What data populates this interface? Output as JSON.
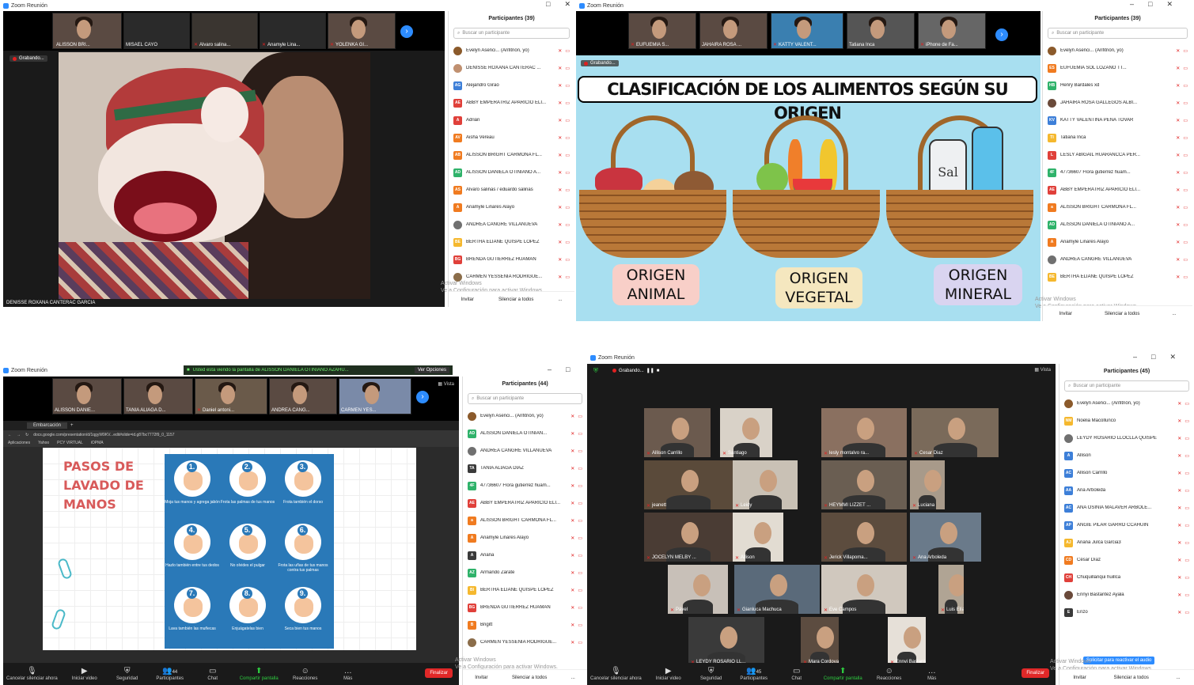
{
  "app_title": "Zoom Reunión",
  "q1": {
    "thumbnails": [
      "ALISSON BRI...",
      "MISAEL CAYO",
      "Alvaro salina...",
      "Anamyle Lina...",
      "YOLENKA GI..."
    ],
    "recording": "Grabando...",
    "speaker": "DENISSE ROXANA CANTERAC GARCIA",
    "panel_title": "Participantes (39)",
    "search_placeholder": "Buscar un participante",
    "participants": [
      {
        "initials": "",
        "name": "Evelyn Asenci... (Anfitrión, yo)",
        "color": "#8b5a2b",
        "photo": true
      },
      {
        "initials": "",
        "name": "DENISSE ROXANA CANTERAC ...",
        "color": "#c09070",
        "photo": true
      },
      {
        "initials": "AG",
        "name": "Alejandro Girao",
        "color": "#3d7fd8"
      },
      {
        "initials": "AE",
        "name": "ABBY EMPERATRIZ APARICIO ELI...",
        "color": "#e0403a"
      },
      {
        "initials": "A",
        "name": "Adrián",
        "color": "#e0403a"
      },
      {
        "initials": "AV",
        "name": "Aisha Vereau",
        "color": "#f07b20"
      },
      {
        "initials": "AB",
        "name": "ALISSON BRIGHT CARMONA FL...",
        "color": "#f07b20"
      },
      {
        "initials": "AD",
        "name": "ALISSON DANIELA OTINIANO A...",
        "color": "#2fb26a"
      },
      {
        "initials": "AS",
        "name": "Alvaro salinas / eduardo salinas",
        "color": "#f07b20"
      },
      {
        "initials": "A",
        "name": "Anamyle Linares Alayo",
        "color": "#f07b20"
      },
      {
        "initials": "",
        "name": "ANDREA CANGRE VILLANUEVA",
        "color": "#707070",
        "photo": true
      },
      {
        "initials": "BE",
        "name": "BERTHA ELIANE QUISPE LOPEZ",
        "color": "#f5b82e"
      },
      {
        "initials": "BG",
        "name": "BRENDA GUTIERREZ HUAMAN",
        "color": "#e0403a"
      },
      {
        "initials": "",
        "name": "CARMEN YESSENIA RODRIGUE...",
        "color": "#8b6d4a",
        "photo": true
      }
    ],
    "invite": "Invitar",
    "mute_all": "Silenciar a todos",
    "more": "...",
    "activate1": "Activar Windows",
    "activate2": "Ve a Configuración para activar Windows."
  },
  "q2": {
    "thumbnails": [
      "EUFUEMIA S...",
      "JAHAIRA ROSA ...",
      "KATTY VALENT...",
      "Tatiana Inca",
      "iPhone de Fa..."
    ],
    "recording": "Grabando...",
    "slide_title": "CLASIFICACIÓN DE LOS ALIMENTOS SEGÚN SU ORIGEN",
    "labels": [
      "ORIGEN ANIMAL",
      "ORIGEN VEGETAL",
      "ORIGEN MINERAL"
    ],
    "salt_text": "Sal",
    "panel_title": "Participantes (39)",
    "search_placeholder": "Buscar un participante",
    "participants": [
      {
        "initials": "",
        "name": "Evelyn Asenci... (Anfitrión, yo)",
        "color": "#8b5a2b",
        "photo": true
      },
      {
        "initials": "ES",
        "name": "EUFUEMIA SOL LOZANO TT...",
        "color": "#f07b20"
      },
      {
        "initials": "HB",
        "name": "Henry Bardales xd",
        "color": "#2fb26a"
      },
      {
        "initials": "",
        "name": "JAHAIRA ROSA GALLEGOS ALBI...",
        "color": "#6a4a3a",
        "photo": true
      },
      {
        "initials": "KV",
        "name": "KATTY VALENTINA PEÑA TOVAR",
        "color": "#3d7fd8"
      },
      {
        "initials": "TI",
        "name": "Tatiana Inca",
        "color": "#f5b82e"
      },
      {
        "initials": "L",
        "name": "LESLY ABIGAIL HUARANCCA PER...",
        "color": "#e0403a"
      },
      {
        "initials": "4F",
        "name": "47736607 Flora gutierrez huam...",
        "color": "#2fb26a"
      },
      {
        "initials": "AE",
        "name": "ABBY EMPERATRIZ APARICIO ELI...",
        "color": "#e0403a"
      },
      {
        "initials": "a",
        "name": "ALISSON BRIGHT CARMONA FL...",
        "color": "#f07b20"
      },
      {
        "initials": "AD",
        "name": "ALISSON DANIELA OTINIANO A...",
        "color": "#2fb26a"
      },
      {
        "initials": "A",
        "name": "Anamyle Linares Alayo",
        "color": "#f07b20"
      },
      {
        "initials": "",
        "name": "ANDREA CANGRE VILLANUEVA",
        "color": "#707070",
        "photo": true
      },
      {
        "initials": "BE",
        "name": "BERTHA ELIANE QUISPE LOPEZ",
        "color": "#f5b82e"
      }
    ],
    "invite": "Invitar",
    "mute_all": "Silenciar a todos",
    "more": "...",
    "activate1": "Activar Windows",
    "activate2": "Ve a Configuración para activar Windows."
  },
  "q3": {
    "share_notice": "Usted está viendo la pantalla de ALISSON DANIELA OTINIANO AZAHU...",
    "view_options": "Ver Opciones",
    "view": "Vista",
    "thumbnails": [
      "ALISSON DANIE...",
      "TANIA ALIAGA D...",
      "Daniel antoni...",
      "ANDREA CANG...",
      "CARMEN YES..."
    ],
    "browser_tab": "Embarcación",
    "url": "docs.google.com/presentation/d/1qgyW9KV...edit#slide=id.g87bc7772f9_0_1157",
    "bookmarks": [
      "Aplicaciones",
      "Yahoo",
      "PCY VIRTUAL",
      "iOPMA"
    ],
    "pasos_title": "PASOS DE LAVADO DE MANOS",
    "steps": [
      {
        "n": "1.",
        "cap": "Moja tus manos y agrega jabón"
      },
      {
        "n": "2.",
        "cap": "Frota las palmas de tus manos"
      },
      {
        "n": "3.",
        "cap": "Frota también el dorso"
      },
      {
        "n": "4.",
        "cap": "Hazlo también entre tus dedos"
      },
      {
        "n": "5.",
        "cap": "No olvides el pulgar"
      },
      {
        "n": "6.",
        "cap": "Frota las uñas de tus manos contra tus palmas"
      },
      {
        "n": "7.",
        "cap": "Lava también las muñecas"
      },
      {
        "n": "8.",
        "cap": "Enjuágatelas bien"
      },
      {
        "n": "9.",
        "cap": "Seca bien tus manos"
      }
    ],
    "toolbar": {
      "mute": "Cancelar silenciar ahora",
      "video": "Iniciar video",
      "security": "Seguridad",
      "participants": "Participantes",
      "participants_count": "44",
      "chat": "Chat",
      "share": "Compartir pantalla",
      "reactions": "Reacciones",
      "more": "Más",
      "end": "Finalizar"
    },
    "panel_title": "Participantes (44)",
    "search_placeholder": "Buscar un participante",
    "participants": [
      {
        "initials": "",
        "name": "Evelyn Asenci... (Anfitrión, yo)",
        "color": "#8b5a2b",
        "photo": true
      },
      {
        "initials": "AD",
        "name": "ALISSON DANIELA OTINIAN...",
        "color": "#2fb26a"
      },
      {
        "initials": "",
        "name": "ANDREA CANGRE VILLANUEVA",
        "color": "#707070",
        "photo": true
      },
      {
        "initials": "TA",
        "name": "TANIA ALIAGA DIAZ",
        "color": "#3a3a3a"
      },
      {
        "initials": "4F",
        "name": "47736607 Flora gutierrez huam...",
        "color": "#2fb26a"
      },
      {
        "initials": "AE",
        "name": "ABBY EMPERATRIZ APARICIO ELI...",
        "color": "#e0403a"
      },
      {
        "initials": "a",
        "name": "ALISSON BRIGHT CARMONA FL...",
        "color": "#f07b20"
      },
      {
        "initials": "A",
        "name": "Anamyle Linares Alayo",
        "color": "#f07b20"
      },
      {
        "initials": "A",
        "name": "Ariana",
        "color": "#3a3a3a"
      },
      {
        "initials": "AZ",
        "name": "Armando Zarate",
        "color": "#2fb26a"
      },
      {
        "initials": "BI",
        "name": "BERTHA ELIANE QUISPE LOPEZ",
        "color": "#f5b82e"
      },
      {
        "initials": "BG",
        "name": "BRENDA GUTIERREZ HUAMAN",
        "color": "#e0403a"
      },
      {
        "initials": "B",
        "name": "Brigitt",
        "color": "#f07b20"
      },
      {
        "initials": "",
        "name": "CARMEN YESSENIA RODRIGUE...",
        "color": "#8b6d4a",
        "photo": true
      }
    ],
    "invite": "Invitar",
    "mute_all": "Silenciar a todos",
    "more": "...",
    "activate1": "Activar Windows",
    "activate2": "Ve a Configuración para activar Windows."
  },
  "q4": {
    "recording": "Grabando...",
    "view": "Vista",
    "tiles": [
      "Allison Carrillo",
      "Santiago",
      "lesly montalvo ra...",
      "Cesar Diaz",
      "jeanett",
      "Leidy",
      "HEYMMI LIZZET ...",
      "Luciana",
      "JOCELYN MELBY ...",
      "Allison",
      "Jerick Villapoma...",
      "Ana Arboleda",
      "Pável",
      "Gianluca Machuca",
      "Eve Campos",
      "Luis Elías",
      "LEYDY ROSARIO LL...",
      "Mara Cordova",
      "Ennyi Bastantez ..."
    ],
    "toolbar": {
      "mute": "Cancelar silenciar ahora",
      "video": "Iniciar video",
      "security": "Seguridad",
      "participants": "Participantes",
      "participants_count": "45",
      "chat": "Chat",
      "share": "Compartir pantalla",
      "reactions": "Reacciones",
      "more": "Más",
      "end": "Finalizar"
    },
    "panel_title": "Participantes (45)",
    "search_placeholder": "Buscar un participante",
    "participants": [
      {
        "initials": "",
        "name": "Evelyn Asenci... (Anfitrión, yo)",
        "color": "#8b5a2b",
        "photo": true
      },
      {
        "initials": "NM",
        "name": "Noelia Macollunco",
        "color": "#f5b82e"
      },
      {
        "initials": "",
        "name": "LEYDY ROSARIO LLOCLLA QUISPE",
        "color": "#707070",
        "photo": true
      },
      {
        "initials": "A",
        "name": "Allison",
        "color": "#3d7fd8"
      },
      {
        "initials": "AC",
        "name": "Allison Carrillo",
        "color": "#3d7fd8"
      },
      {
        "initials": "AA",
        "name": "Ana Arboleda",
        "color": "#3d7fd8"
      },
      {
        "initials": "AC",
        "name": "ANA OSINIA MALAVER ARBOLE...",
        "color": "#3d7fd8"
      },
      {
        "initials": "AP",
        "name": "ANGIE PILAR GARRO CCAHUIN",
        "color": "#3d7fd8"
      },
      {
        "initials": "AJ",
        "name": "Ariana Julca Garcia3",
        "color": "#f5b82e"
      },
      {
        "initials": "CD",
        "name": "César Díaz",
        "color": "#f07b20"
      },
      {
        "initials": "CH",
        "name": "Chuquillanqui huillca",
        "color": "#e0403a"
      },
      {
        "initials": "",
        "name": "Ennyi Bastantez Ayala",
        "color": "#6a4a3a",
        "photo": true
      },
      {
        "initials": "E",
        "name": "Enzo",
        "color": "#3a3a3a"
      }
    ],
    "request_unmute": "Solicitar para reactivar el audio",
    "invite": "Invitar",
    "mute_all": "Silenciar a todos",
    "more": "...",
    "activate1": "Activar Windows",
    "activate2": "Ve a Configuración para activar Windows."
  }
}
